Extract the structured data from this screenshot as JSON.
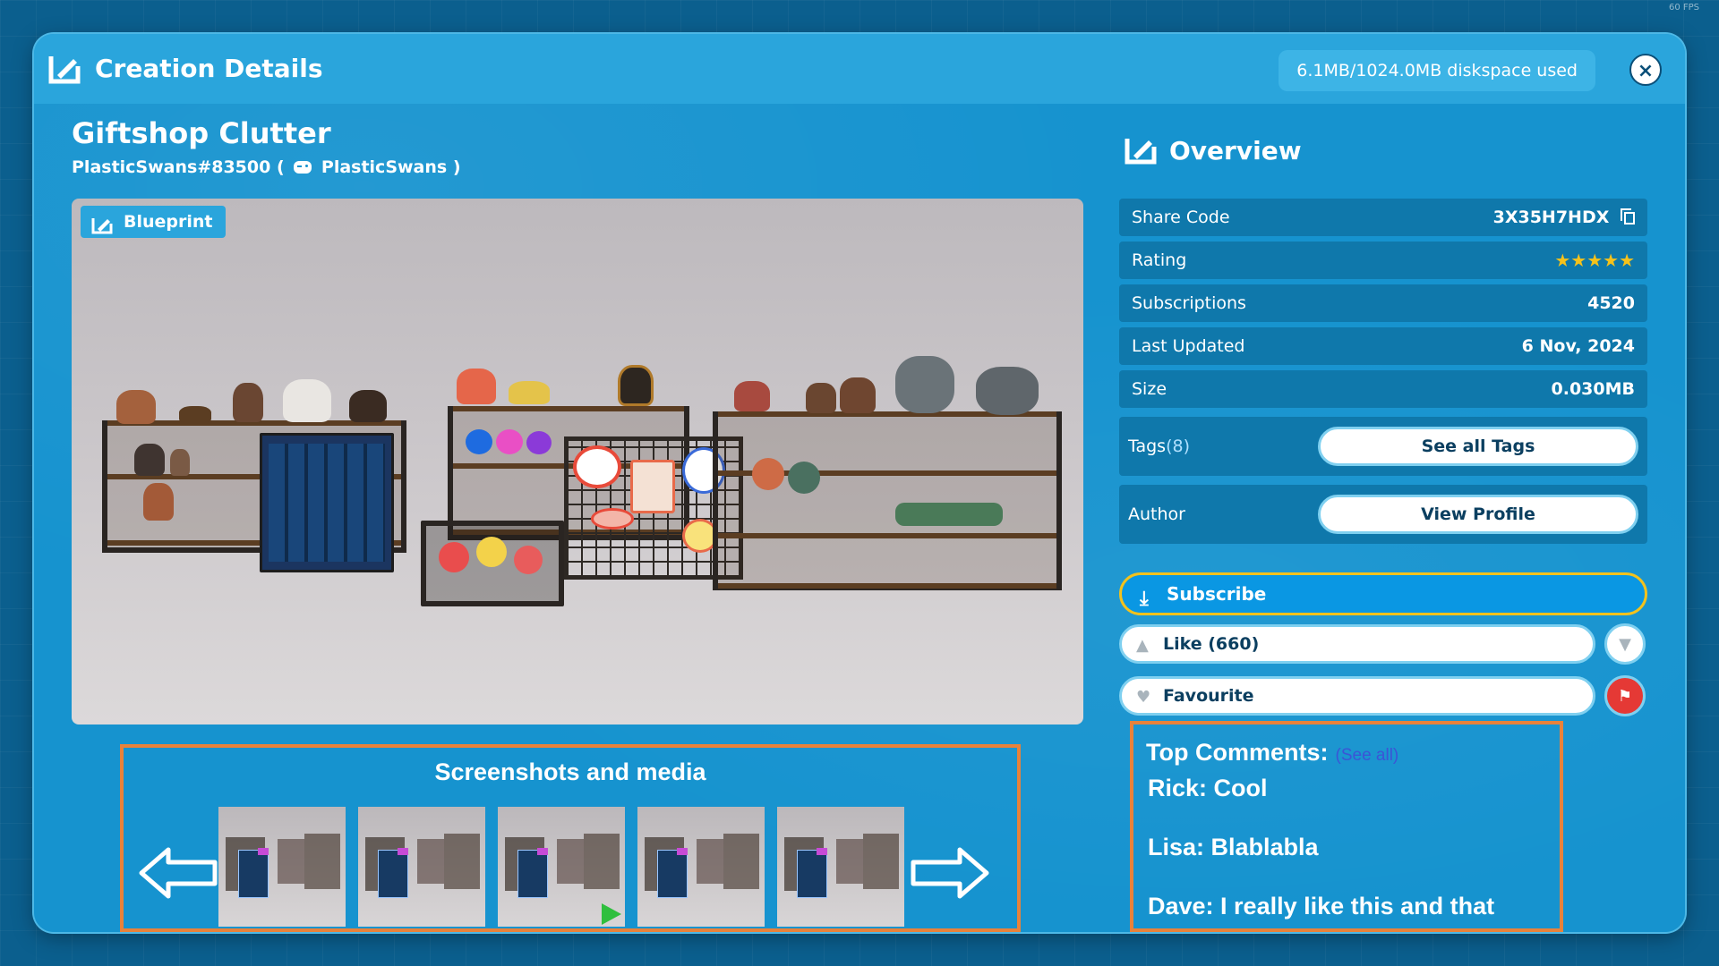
{
  "fps": "60 FPS",
  "header": {
    "title": "Creation Details",
    "disk_usage": "6.1MB/1024.0MB diskspace used",
    "close_label": "×"
  },
  "item": {
    "title": "Giftshop Clutter",
    "author_id": "PlasticSwans#83500 (",
    "author_name": "PlasticSwans )",
    "badge": "Blueprint"
  },
  "media": {
    "title": "Screenshots and media",
    "thumbnail_count": 5,
    "video_thumbnail_index": 2
  },
  "overview": {
    "title": "Overview",
    "share_code_label": "Share Code",
    "share_code": "3X35H7HDX",
    "rating_label": "Rating",
    "rating_stars": "★★★★★",
    "rating_value": 5,
    "subscriptions_label": "Subscriptions",
    "subscriptions": "4520",
    "last_updated_label": "Last Updated",
    "last_updated": "6 Nov, 2024",
    "size_label": "Size",
    "size": "0.030MB",
    "tags_label": "Tags",
    "tags_count": "(8)",
    "see_all_tags": "See all Tags",
    "author_label": "Author",
    "view_profile": "View Profile"
  },
  "actions": {
    "subscribe": "Subscribe",
    "like": "Like (660)",
    "favourite": "Favourite"
  },
  "comments": {
    "title": "Top Comments:",
    "see_all": "(See all)",
    "items": [
      "Rick: Cool",
      "Lisa: Blablabla",
      "Dave: I really like this and that"
    ]
  },
  "colors": {
    "accent": "#1693cf",
    "subscribe_border": "#f3c21d",
    "report": "#e53935",
    "annotation": "#e8823b"
  }
}
